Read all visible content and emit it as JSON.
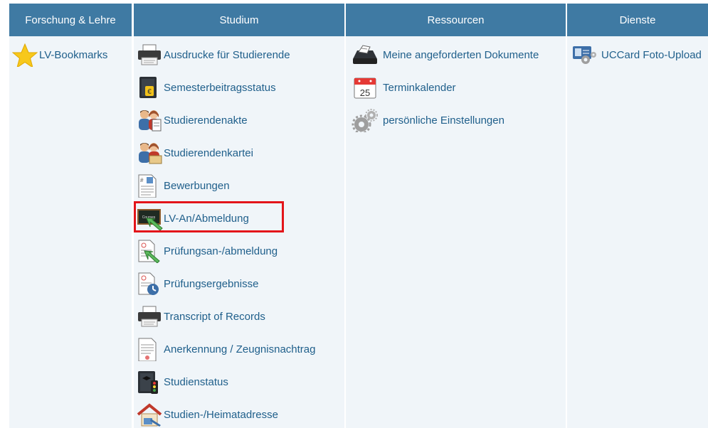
{
  "columns": [
    {
      "header": "Forschung & Lehre",
      "items": [
        {
          "label": "LV-Bookmarks",
          "icon": "star-icon"
        }
      ]
    },
    {
      "header": "Studium",
      "items": [
        {
          "label": "Ausdrucke für Studierende",
          "icon": "printer-icon"
        },
        {
          "label": "Semesterbeitragsstatus",
          "icon": "fee-book-icon"
        },
        {
          "label": "Studierendenakte",
          "icon": "students-file-icon"
        },
        {
          "label": "Studierendenkartei",
          "icon": "students-card-icon"
        },
        {
          "label": "Bewerbungen",
          "icon": "application-document-icon"
        },
        {
          "label": "LV-An/Abmeldung",
          "icon": "course-blackboard-icon"
        },
        {
          "label": "Prüfungsan-/abmeldung",
          "icon": "exam-registration-icon"
        },
        {
          "label": "Prüfungsergebnisse",
          "icon": "exam-results-icon"
        },
        {
          "label": "Transcript of Records",
          "icon": "printer-icon"
        },
        {
          "label": "Anerkennung / Zeugnisnachtrag",
          "icon": "certificate-document-icon"
        },
        {
          "label": "Studienstatus",
          "icon": "study-status-icon"
        },
        {
          "label": "Studien-/Heimatadresse",
          "icon": "home-address-icon"
        }
      ]
    },
    {
      "header": "Ressourcen",
      "items": [
        {
          "label": "Meine angeforderten Dokumente",
          "icon": "document-printer-icon"
        },
        {
          "label": "Terminkalender",
          "icon": "calendar-icon",
          "calendar_day": "25"
        },
        {
          "label": "persönliche Einstellungen",
          "icon": "gears-icon"
        }
      ]
    },
    {
      "header": "Dienste",
      "items": [
        {
          "label": "UCCard Foto-Upload",
          "icon": "photo-card-upload-icon"
        }
      ]
    }
  ],
  "highlighted_item": "LV-An/Abmeldung",
  "blackboard_text": "Courses",
  "colors": {
    "header_bg": "#3f7aa3",
    "column_bg": "#f0f5f9",
    "link": "#1f5f8b",
    "highlight": "#e3151a"
  }
}
